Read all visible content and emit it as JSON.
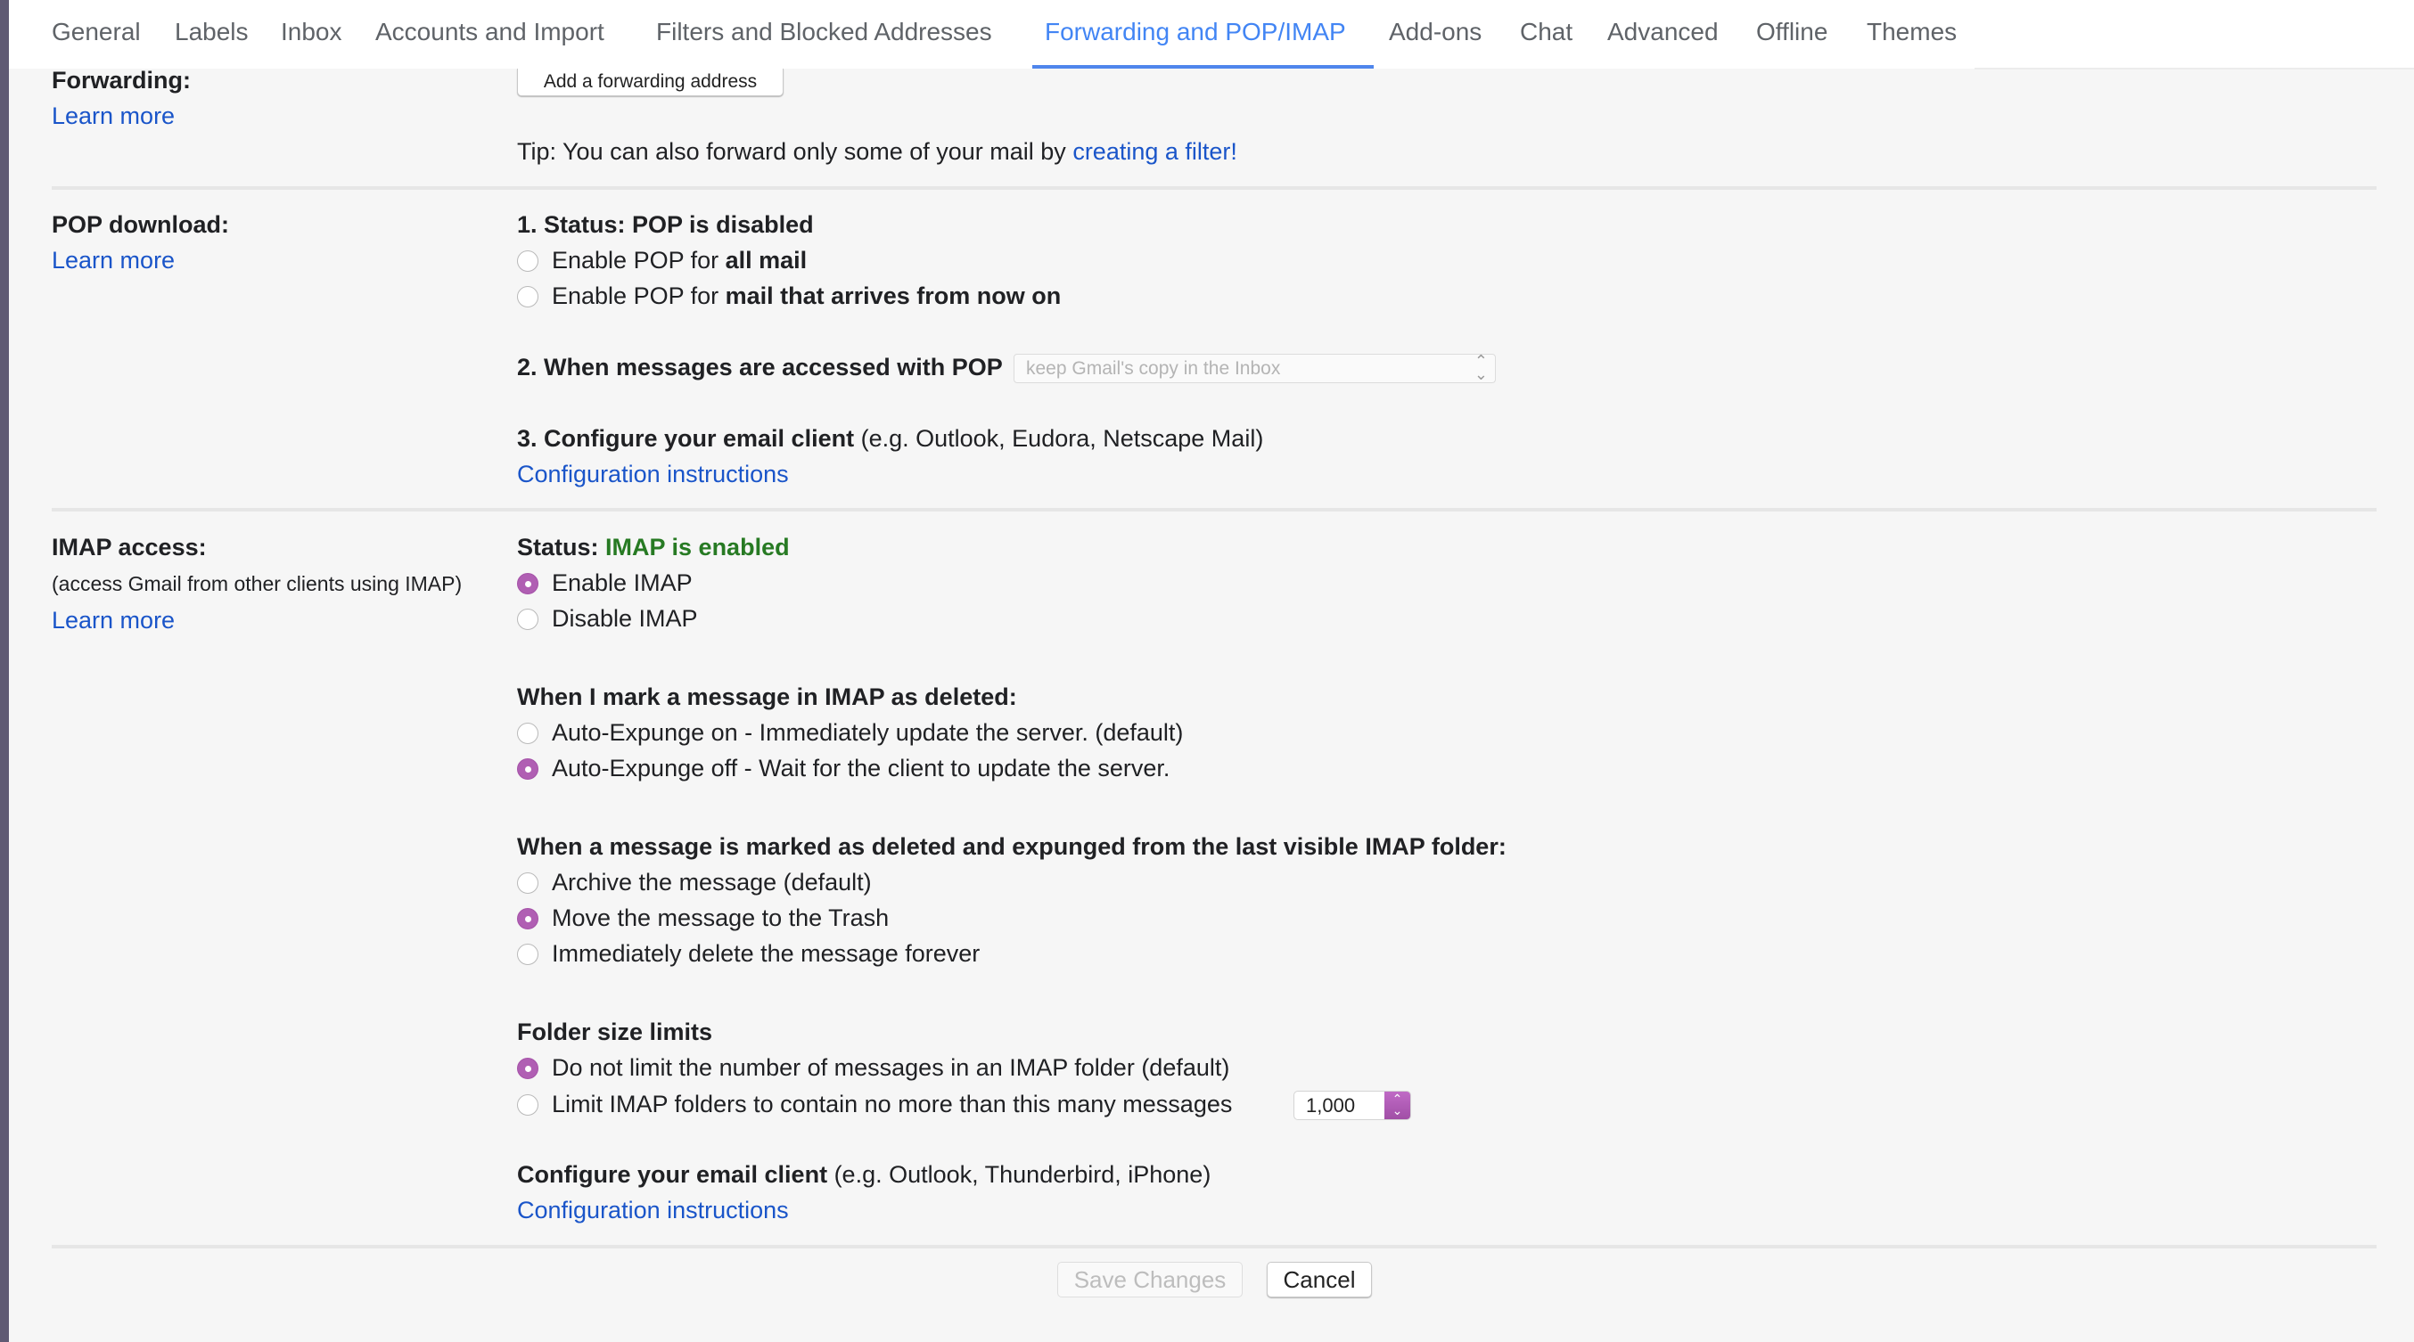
{
  "tabs": [
    {
      "label": "General",
      "active": false
    },
    {
      "label": "Labels",
      "active": false
    },
    {
      "label": "Inbox",
      "active": false
    },
    {
      "label": "Accounts and Import",
      "active": false
    },
    {
      "label": "Filters and Blocked Addresses",
      "active": false
    },
    {
      "label": "Forwarding and POP/IMAP",
      "active": true
    },
    {
      "label": "Add-ons",
      "active": false
    },
    {
      "label": "Chat",
      "active": false
    },
    {
      "label": "Advanced",
      "active": false
    },
    {
      "label": "Offline",
      "active": false
    },
    {
      "label": "Themes",
      "active": false
    }
  ],
  "forwarding": {
    "title": "Forwarding:",
    "learn_more": "Learn more",
    "add_button": "Add a forwarding address",
    "tip_prefix": "Tip: You can also forward only some of your mail by ",
    "tip_link": "creating a filter!"
  },
  "pop": {
    "title": "POP download:",
    "learn_more": "Learn more",
    "status": "1. Status: POP is disabled",
    "options": [
      {
        "prefix": "Enable POP for ",
        "bold": "all mail",
        "checked": false
      },
      {
        "prefix": "Enable POP for ",
        "bold": "mail that arrives from now on",
        "checked": false
      }
    ],
    "access_label": "2. When messages are accessed with POP",
    "access_select": "keep Gmail's copy in the Inbox",
    "configure_bold": "3. Configure your email client",
    "configure_rest": " (e.g. Outlook, Eudora, Netscape Mail)",
    "config_link": "Configuration instructions"
  },
  "imap": {
    "title": "IMAP access:",
    "subtitle": "(access Gmail from other clients using IMAP)",
    "learn_more": "Learn more",
    "status_label": "Status: ",
    "status_value": "IMAP is enabled",
    "access_options": [
      {
        "label": "Enable IMAP",
        "checked": true
      },
      {
        "label": "Disable IMAP",
        "checked": false
      }
    ],
    "deleted_heading": "When I mark a message in IMAP as deleted:",
    "deleted_options": [
      {
        "label": "Auto-Expunge on - Immediately update the server. (default)",
        "checked": false
      },
      {
        "label": "Auto-Expunge off - Wait for the client to update the server.",
        "checked": true
      }
    ],
    "expunged_heading": "When a message is marked as deleted and expunged from the last visible IMAP folder:",
    "expunged_options": [
      {
        "label": "Archive the message (default)",
        "checked": false
      },
      {
        "label": "Move the message to the Trash",
        "checked": true
      },
      {
        "label": "Immediately delete the message forever",
        "checked": false
      }
    ],
    "folder_heading": "Folder size limits",
    "folder_options": [
      {
        "label": "Do not limit the number of messages in an IMAP folder (default)",
        "checked": true
      },
      {
        "label": "Limit IMAP folders to contain no more than this many messages",
        "checked": false
      }
    ],
    "folder_limit_value": "1,000",
    "configure_bold": "Configure your email client",
    "configure_rest": " (e.g. Outlook, Thunderbird, iPhone)",
    "config_link": "Configuration instructions"
  },
  "footer": {
    "save": "Save Changes",
    "cancel": "Cancel"
  },
  "colors": {
    "accent": "#4285f4",
    "link": "#1a55c9",
    "status_green": "#277a23",
    "radio_checked": "#b05fb3"
  }
}
